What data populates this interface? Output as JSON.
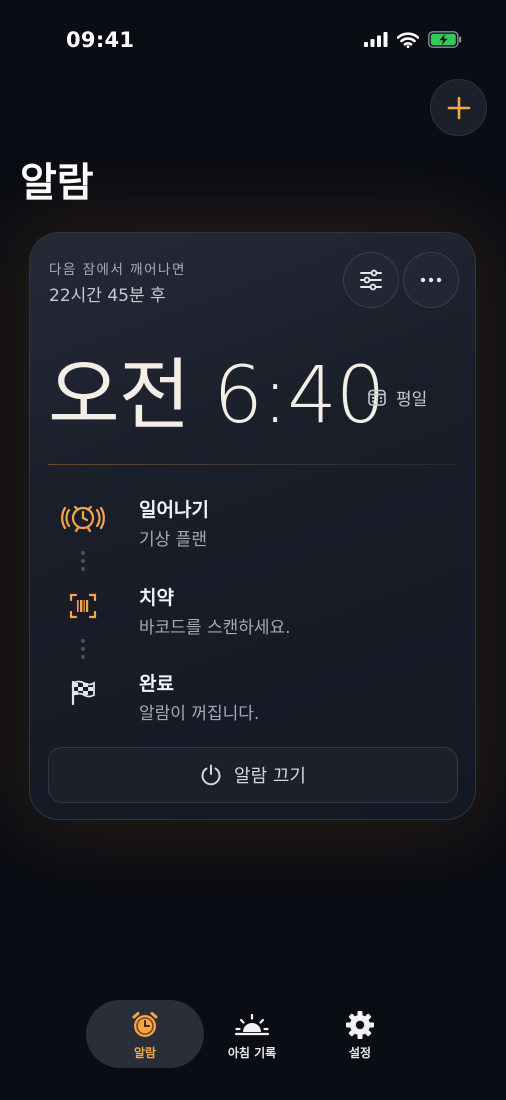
{
  "status_bar": {
    "time": "09:41"
  },
  "header": {
    "title": "알람"
  },
  "card": {
    "next_label": "다음 잠에서 깨어나면",
    "next_time": "22시간 45분 후",
    "alarm_time": "오전 6:40",
    "repeat": "평일",
    "steps": [
      {
        "title": "일어나기",
        "desc": "기상 플랜",
        "icon": "alarm-ringing-icon"
      },
      {
        "title": "치약",
        "desc": "바코드를 스캔하세요.",
        "icon": "barcode-scan-icon"
      },
      {
        "title": "완료",
        "desc": "알람이 꺼집니다.",
        "icon": "checkered-flag-icon"
      }
    ],
    "off_button": "알람 끄기"
  },
  "tabs": [
    {
      "label": "알람",
      "icon": "alarm-clock-icon",
      "active": true
    },
    {
      "label": "아침 기록",
      "icon": "sunrise-icon",
      "active": false
    },
    {
      "label": "설정",
      "icon": "gear-icon",
      "active": false
    }
  ],
  "colors": {
    "accent": "#f5a54a",
    "background": "#0a0d14",
    "card": "#1a1e29"
  }
}
